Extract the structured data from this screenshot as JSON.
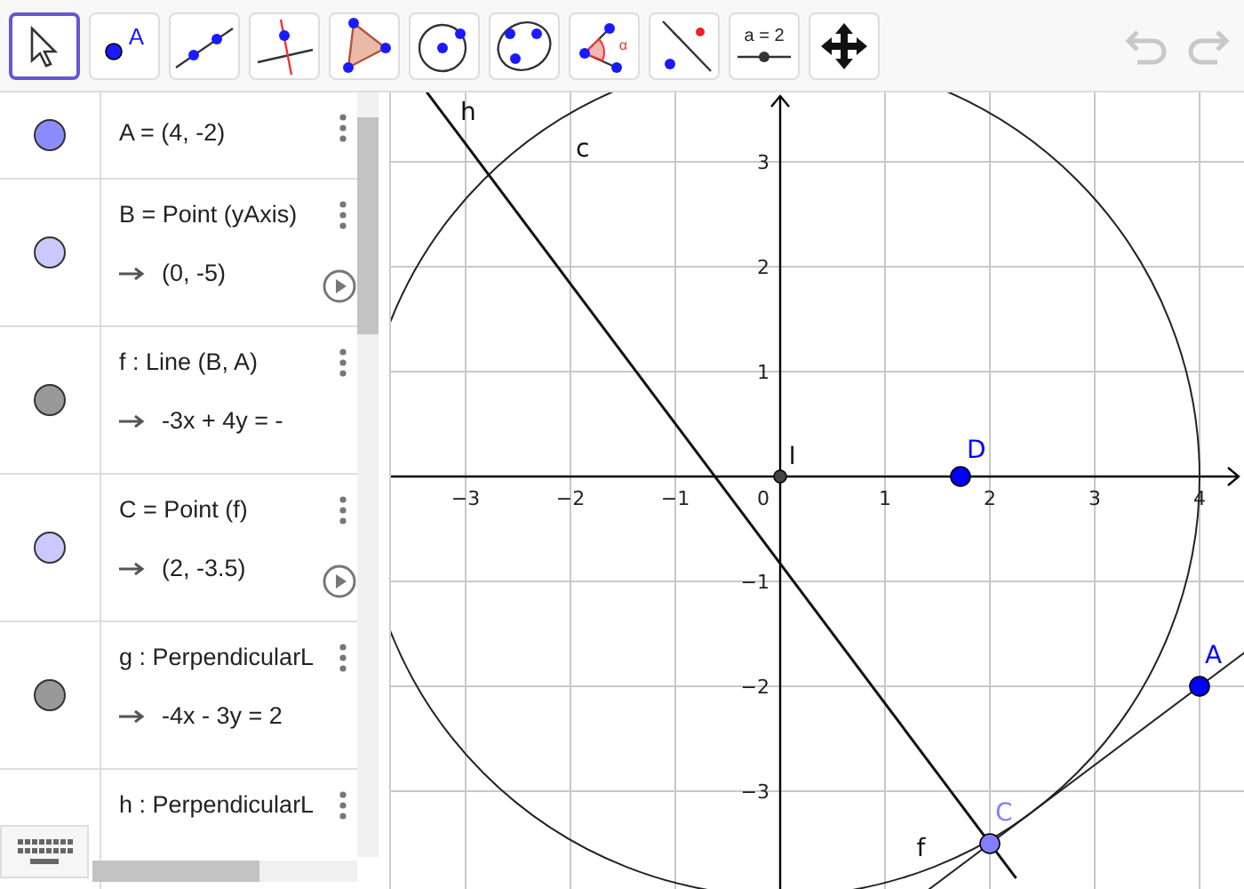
{
  "toolbar": {
    "tools": [
      {
        "kind": "move",
        "selected": true
      },
      {
        "kind": "point",
        "label": "A",
        "selected": false
      },
      {
        "kind": "line",
        "selected": false
      },
      {
        "kind": "perpendicular",
        "selected": false
      },
      {
        "kind": "polygon",
        "selected": false
      },
      {
        "kind": "circle",
        "selected": false
      },
      {
        "kind": "conic",
        "selected": false
      },
      {
        "kind": "angle",
        "label": "α",
        "selected": false
      },
      {
        "kind": "reflect",
        "selected": false
      },
      {
        "kind": "slider",
        "label": "a = 2",
        "selected": false
      },
      {
        "kind": "move-view",
        "selected": false
      }
    ],
    "undo": {
      "disabled": true
    },
    "redo": {
      "disabled": true
    }
  },
  "algebra": {
    "items": [
      {
        "color": "#8c8cff",
        "definition": "A = (4, -2)"
      },
      {
        "color": "#c9c9ff",
        "definition": "B = Point (yAxis)",
        "value": "(0, -5)",
        "animation_button": true
      },
      {
        "color": "#999999",
        "definition": "f : Line (B, A)",
        "value": "-3x + 4y = -"
      },
      {
        "color": "#c9c9ff",
        "definition": "C = Point (f)",
        "value": "(2, -3.5)",
        "animation_button": true
      },
      {
        "color": "#999999",
        "definition": "g : PerpendicularL",
        "value": "-4x - 3y = 2"
      },
      {
        "definition": "h : PerpendicularL"
      }
    ]
  },
  "graphics": {
    "x_ticks": [
      "−3",
      "−2",
      "−1",
      "1",
      "2",
      "3",
      "4"
    ],
    "y_ticks": [
      "3",
      "2",
      "1",
      "−1",
      "−2",
      "−3"
    ],
    "origin_label": "0",
    "labels": [
      {
        "text": "h"
      },
      {
        "text": "c"
      },
      {
        "text": "f"
      }
    ],
    "points": [
      {
        "label": "A",
        "color": "#0000ff"
      },
      {
        "label": "C",
        "color": "#8080ff"
      },
      {
        "label": "D",
        "color": "#0000ff"
      },
      {
        "label": "I",
        "color": "#444444"
      }
    ]
  }
}
